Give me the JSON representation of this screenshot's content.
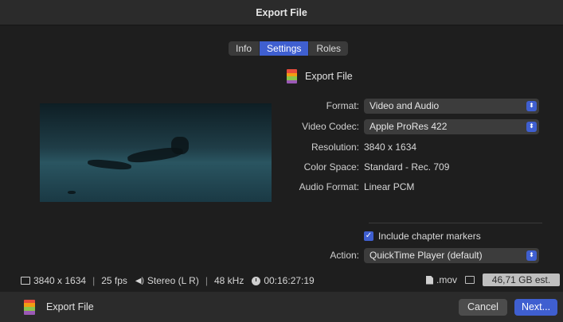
{
  "window": {
    "title": "Export File"
  },
  "tabs": [
    {
      "label": "Info",
      "active": false
    },
    {
      "label": "Settings",
      "active": true
    },
    {
      "label": "Roles",
      "active": false
    }
  ],
  "header": {
    "label": "Export File",
    "icon": "final-cut-export-icon"
  },
  "form": {
    "format": {
      "label": "Format:",
      "value": "Video and Audio"
    },
    "video_codec": {
      "label": "Video Codec:",
      "value": "Apple ProRes 422"
    },
    "resolution": {
      "label": "Resolution:",
      "value": "3840 x 1634"
    },
    "color_space": {
      "label": "Color Space:",
      "value": "Standard - Rec. 709"
    },
    "audio_format": {
      "label": "Audio Format:",
      "value": "Linear PCM"
    },
    "chapter_markers": {
      "label": "Include chapter markers",
      "checked": true
    },
    "action": {
      "label": "Action:",
      "value": "QuickTime Player (default)"
    }
  },
  "status": {
    "resolution": "3840 x 1634",
    "fps": "25 fps",
    "audio_channels": "Stereo (L R)",
    "sample_rate": "48 kHz",
    "duration": "00:16:27:19",
    "extension": ".mov",
    "estimate": "46,71 GB est."
  },
  "footer": {
    "label": "Export File",
    "cancel_label": "Cancel",
    "next_label": "Next..."
  },
  "colors": {
    "accent": "#3f5fd0",
    "background": "#1e1e1e",
    "bar": "#2b2b2b"
  }
}
